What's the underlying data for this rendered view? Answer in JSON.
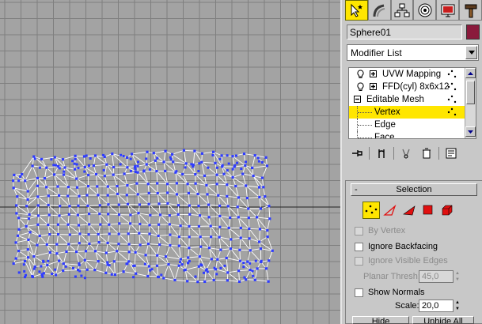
{
  "viewport": {
    "background": "#a3a3a3",
    "grid_color": "#7f7f7f",
    "horizon_color": "#222222",
    "wire_color": "#ffffff",
    "vertex_color": "#2f3cff"
  },
  "command_panel": {
    "tabs": [
      {
        "name": "create-tab",
        "icon": "cursor-star-icon",
        "active": true
      },
      {
        "name": "modify-tab",
        "icon": "modify-bend-icon",
        "active": false
      },
      {
        "name": "hierarchy-tab",
        "icon": "hierarchy-icon",
        "active": false
      },
      {
        "name": "motion-tab",
        "icon": "motion-icon",
        "active": false
      },
      {
        "name": "display-tab",
        "icon": "display-icon",
        "active": false
      },
      {
        "name": "utilities-tab",
        "icon": "hammer-icon",
        "active": false
      }
    ],
    "object_name": "Sphere01",
    "object_color": "#8a1a3c",
    "modifier_list": "Modifier List",
    "stack": [
      {
        "label": "UVW Mapping",
        "level": "modifier"
      },
      {
        "label": "FFD(cyl) 8x6x12",
        "level": "modifier"
      },
      {
        "label": "Editable Mesh",
        "level": "base"
      },
      {
        "label": "Vertex",
        "level": "sub",
        "selected": true
      },
      {
        "label": "Edge",
        "level": "sub"
      },
      {
        "label": "Face",
        "level": "sub"
      }
    ]
  },
  "selection": {
    "title": "Selection",
    "collapse": "-",
    "by_vertex": "By Vertex",
    "ignore_backfacing": "Ignore Backfacing",
    "ignore_visible_edges": "Ignore Visible Edges",
    "planar_thresh_label": "Planar Thresh:",
    "planar_thresh_value": "45,0",
    "show_normals": "Show Normals",
    "scale_label": "Scale:",
    "scale_value": "20,0",
    "hide": "Hide",
    "unhide_all": "Unhide All"
  }
}
